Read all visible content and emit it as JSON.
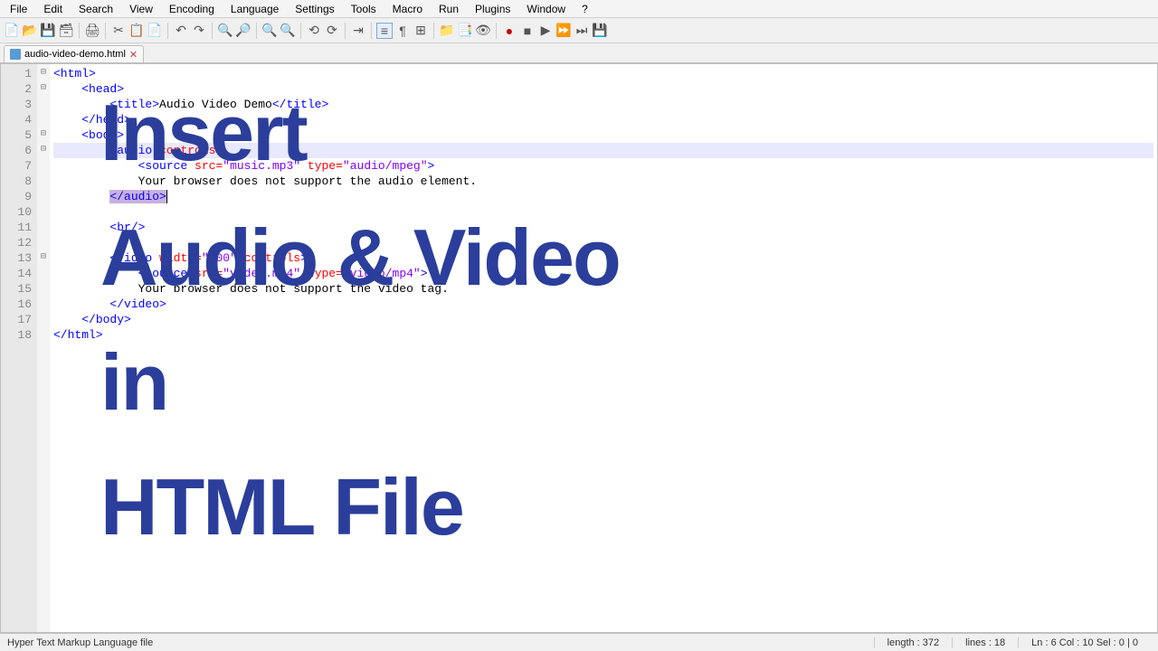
{
  "menu": {
    "items": [
      "File",
      "Edit",
      "Search",
      "View",
      "Encoding",
      "Language",
      "Settings",
      "Tools",
      "Macro",
      "Run",
      "Plugins",
      "Window",
      "?"
    ]
  },
  "tab": {
    "name": "audio-video-demo.html"
  },
  "code": {
    "lines": [
      {
        "n": 1,
        "fold": "⊟",
        "html": "<span class='tag'>&lt;html&gt;</span>"
      },
      {
        "n": 2,
        "fold": "⊟",
        "html": "    <span class='tag'>&lt;head&gt;</span>"
      },
      {
        "n": 3,
        "fold": "",
        "html": "        <span class='tag'>&lt;title&gt;</span><span class='txt'>Audio Video Demo</span><span class='tag'>&lt;/title&gt;</span>"
      },
      {
        "n": 4,
        "fold": "",
        "html": "    <span class='tag'>&lt;/head&gt;</span>"
      },
      {
        "n": 5,
        "fold": "⊟",
        "html": "    <span class='tag'>&lt;body&gt;</span>"
      },
      {
        "n": 6,
        "fold": "⊟",
        "hl": true,
        "html": "        <span class='tag'>&lt;audio</span> <span class='attr'>controls</span><span class='tag'>&gt;</span>"
      },
      {
        "n": 7,
        "fold": "",
        "html": "            <span class='tag'>&lt;source</span> <span class='attr'>src=</span><span class='str'>\"music.mp3\"</span> <span class='attr'>type=</span><span class='str'>\"audio/mpeg\"</span><span class='tag'>&gt;</span>"
      },
      {
        "n": 8,
        "fold": "",
        "html": "            <span class='txt'>Your browser does not support the audio element.</span>"
      },
      {
        "n": 9,
        "fold": "",
        "html": "        <span class='hltag'>&lt;/audio&gt;</span><span class='cursor'> </span>"
      },
      {
        "n": 10,
        "fold": "",
        "html": ""
      },
      {
        "n": 11,
        "fold": "",
        "html": "        <span class='tag'>&lt;br/&gt;</span>"
      },
      {
        "n": 12,
        "fold": "",
        "html": ""
      },
      {
        "n": 13,
        "fold": "⊟",
        "html": "        <span class='tag'>&lt;video</span> <span class='attr'>width=</span><span class='str'>\"400\"</span> <span class='attr'>controls</span><span class='tag'>&gt;</span>"
      },
      {
        "n": 14,
        "fold": "",
        "html": "            <span class='tag'>&lt;source</span> <span class='attr'>src=</span><span class='str'>\"video.mp4\"</span> <span class='attr'>type=</span><span class='str'>\"video/mp4\"</span><span class='tag'>&gt;</span>"
      },
      {
        "n": 15,
        "fold": "",
        "html": "            <span class='txt'>Your browser does not support the video tag.</span>"
      },
      {
        "n": 16,
        "fold": "",
        "html": "        <span class='tag'>&lt;/video&gt;</span>"
      },
      {
        "n": 17,
        "fold": "",
        "html": "    <span class='tag'>&lt;/body&gt;</span>"
      },
      {
        "n": 18,
        "fold": "",
        "html": "<span class='tag'>&lt;/html&gt;</span>"
      }
    ]
  },
  "overlay": {
    "l1": "Insert",
    "l2": "Audio & Video",
    "l3": "in",
    "l4": "HTML File"
  },
  "status": {
    "lang": "Hyper Text Markup Language file",
    "length": "length : 372",
    "lines": "lines : 18",
    "pos": "Ln : 6    Col : 10    Sel : 0 | 0"
  }
}
